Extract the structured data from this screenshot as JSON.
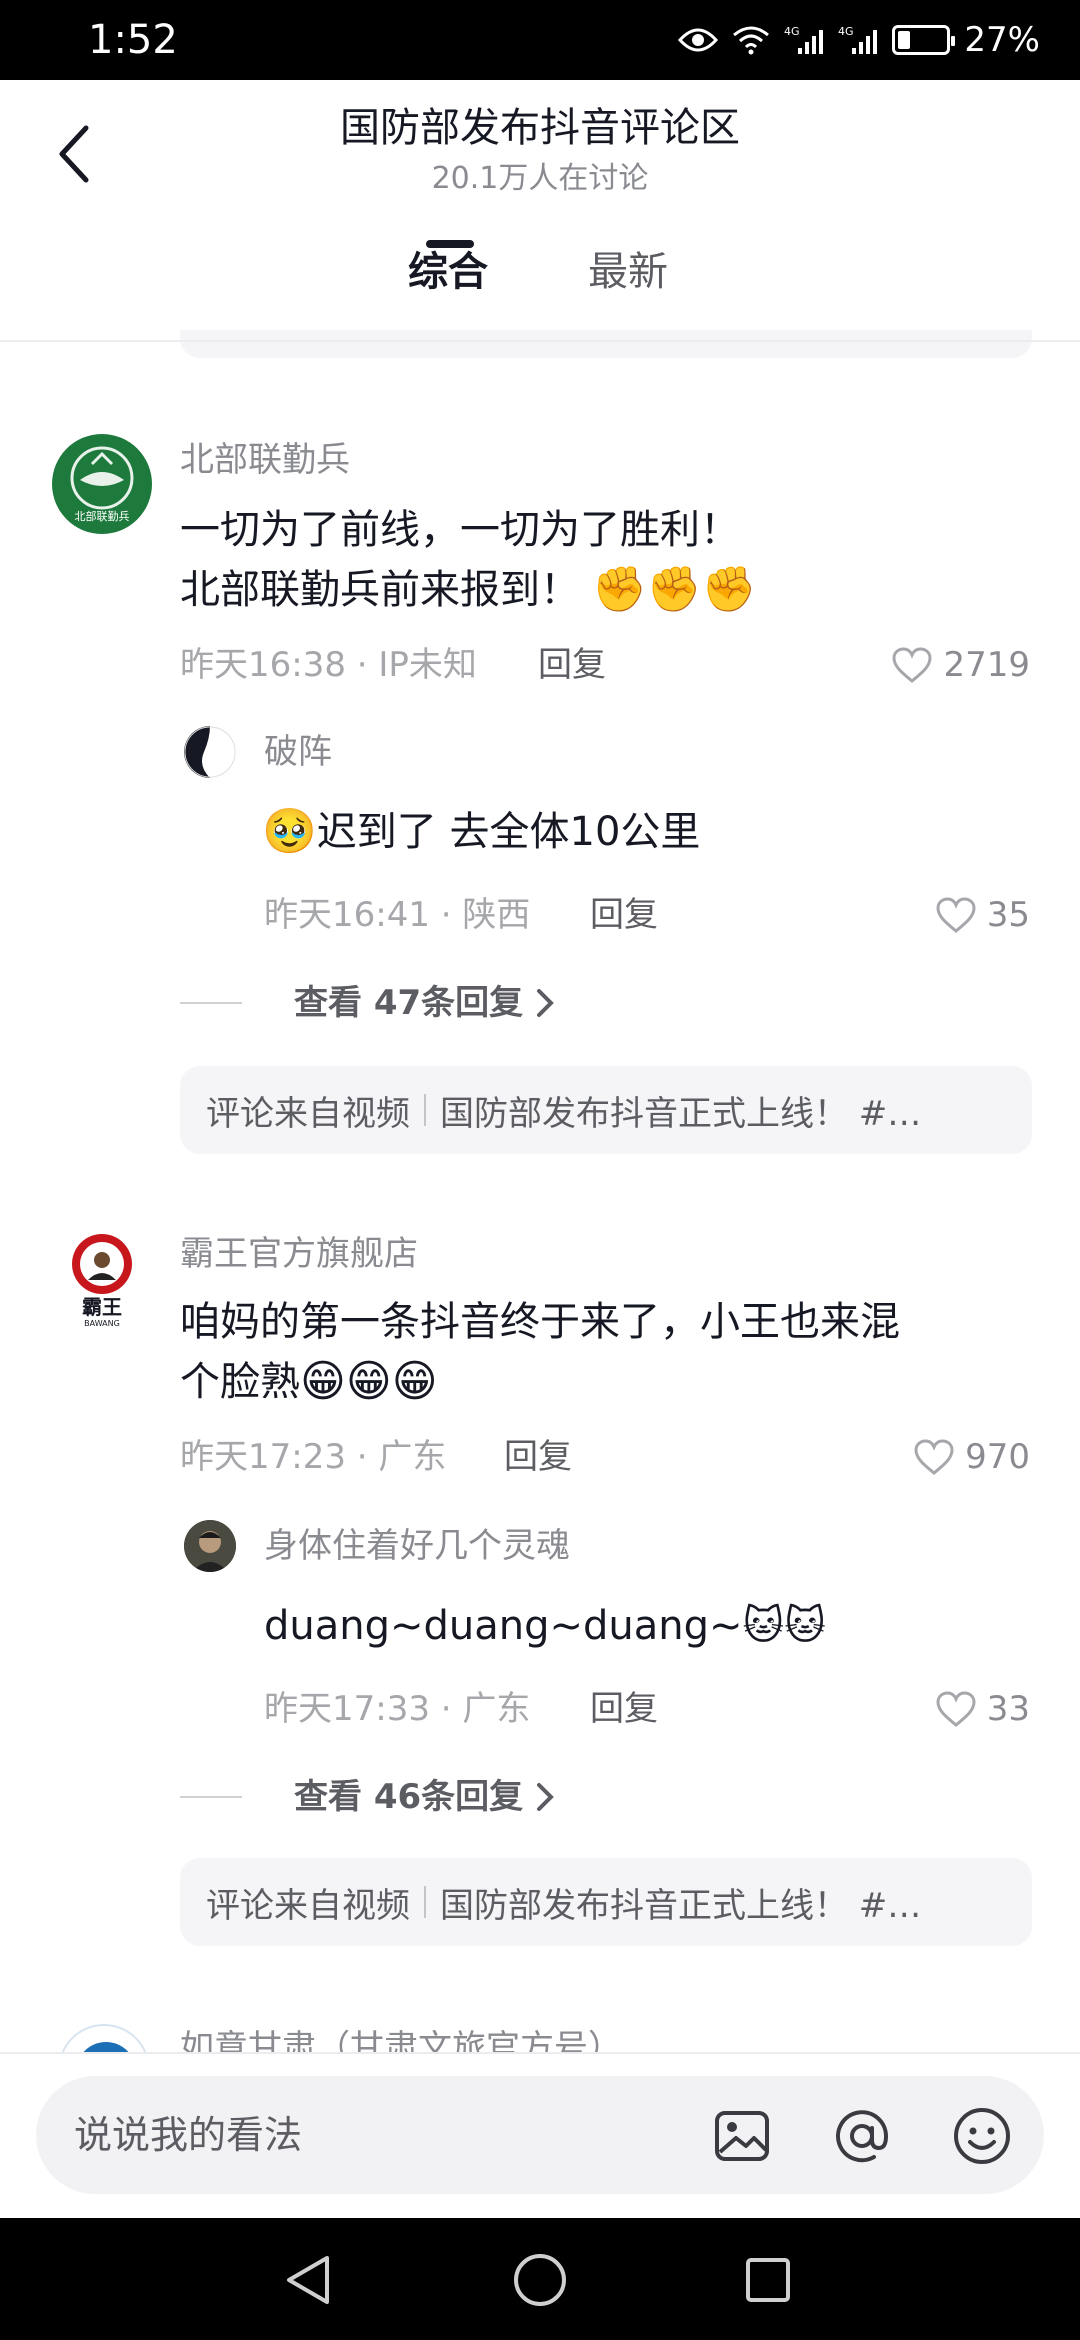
{
  "status_bar": {
    "time": "1:52",
    "network_1": "4G",
    "network_2": "4G",
    "battery_percent": "27%",
    "battery_level": 0.27
  },
  "header": {
    "title": "国防部发布抖音评论区",
    "subtitle": "20.1万人在讨论",
    "tabs": [
      {
        "label": "综合",
        "active": true
      },
      {
        "label": "最新",
        "active": false
      }
    ]
  },
  "comments": [
    {
      "author": "北部联勤兵",
      "avatar_text": "北部联勤兵",
      "text_line1": "一切为了前线，一切为了胜利！",
      "text_line2": "北部联勤兵前来报到！",
      "text_emoji": "✊✊✊",
      "meta": "昨天16:38 · IP未知",
      "reply_label": "回复",
      "likes": "2719",
      "reply": {
        "author": "破阵",
        "emoji": "🥹",
        "text": "迟到了 去全体10公里",
        "meta": "昨天16:41 · 陕西",
        "reply_label": "回复",
        "likes": "35"
      },
      "more_replies": "查看 47条回复",
      "source_label": "评论来自视频",
      "source_title": "国防部发布抖音正式上线！ #…"
    },
    {
      "author": "霸王官方旗舰店",
      "avatar_text": "霸王",
      "avatar_subtext": "BAWANG",
      "text_line1": "咱妈的第一条抖音终于来了，小王也来混",
      "text_line2": "个脸熟",
      "text_emoji": "😁😁😁",
      "meta": "昨天17:23 · 广东",
      "reply_label": "回复",
      "likes": "970",
      "reply": {
        "author": "身体住着好几个灵魂",
        "text": "duang~duang~duang~",
        "emoji": "🐱🐱",
        "meta": "昨天17:33 · 广东",
        "reply_label": "回复",
        "likes": "33"
      },
      "more_replies": "查看 46条回复",
      "source_label": "评论来自视频",
      "source_title": "国防部发布抖音正式上线！ #…"
    },
    {
      "author": "如意甘肃（甘肃文旅官方号）"
    }
  ],
  "input": {
    "placeholder": "说说我的看法",
    "icons": [
      "image-icon",
      "at-icon",
      "emoji-icon"
    ]
  },
  "nav_bar": {
    "icons": [
      "back-triangle-icon",
      "home-circle-icon",
      "recents-square-icon"
    ]
  },
  "colors": {
    "text_primary": "#161823",
    "text_secondary": "#8a8b91",
    "card_bg": "#f5f5f7",
    "avatar_green": "#1e7a3c",
    "avatar_red": "#c8161d"
  }
}
